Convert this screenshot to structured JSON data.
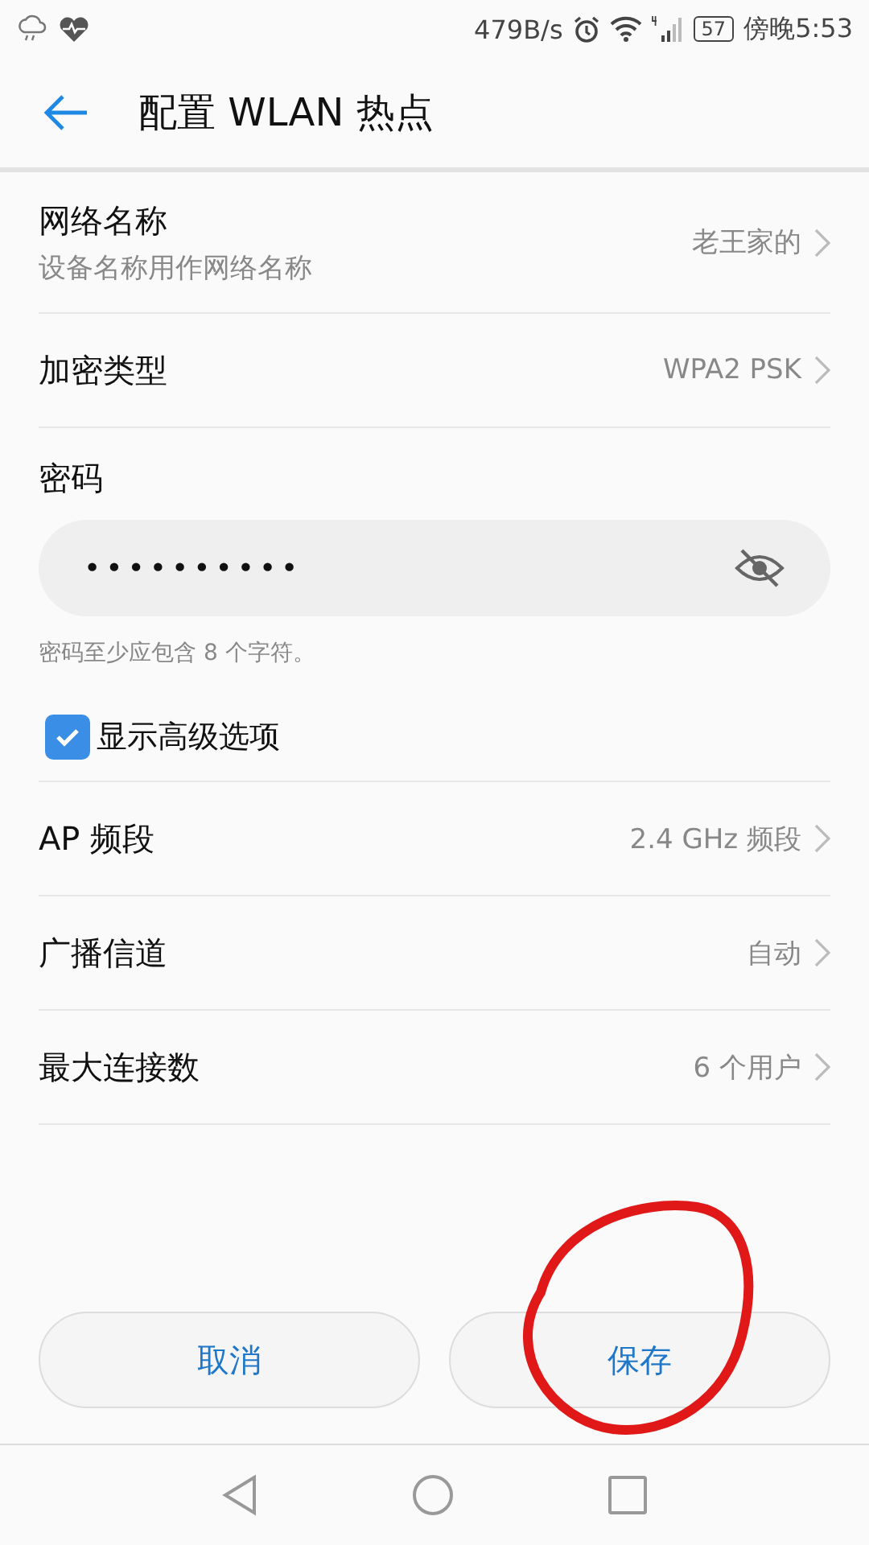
{
  "status_bar": {
    "speed": "479B/s",
    "battery": "57",
    "time": "傍晚5:53"
  },
  "header": {
    "title": "配置 WLAN 热点"
  },
  "settings": [
    {
      "label": "网络名称",
      "subtitle": "设备名称用作网络名称",
      "value": "老王家的"
    },
    {
      "label": "加密类型",
      "value": "WPA2 PSK"
    }
  ],
  "password": {
    "label": "密码",
    "value": "••••••••••",
    "hint": "密码至少应包含 8 个字符。",
    "visible": false
  },
  "advanced": {
    "label": "显示高级选项",
    "checked": true
  },
  "advanced_settings": [
    {
      "label": "AP 频段",
      "value": "2.4 GHz 频段"
    },
    {
      "label": "广播信道",
      "value": "自动"
    },
    {
      "label": "最大连接数",
      "value": "6 个用户"
    }
  ],
  "buttons": [
    {
      "label": "取消"
    },
    {
      "label": "保存"
    }
  ]
}
